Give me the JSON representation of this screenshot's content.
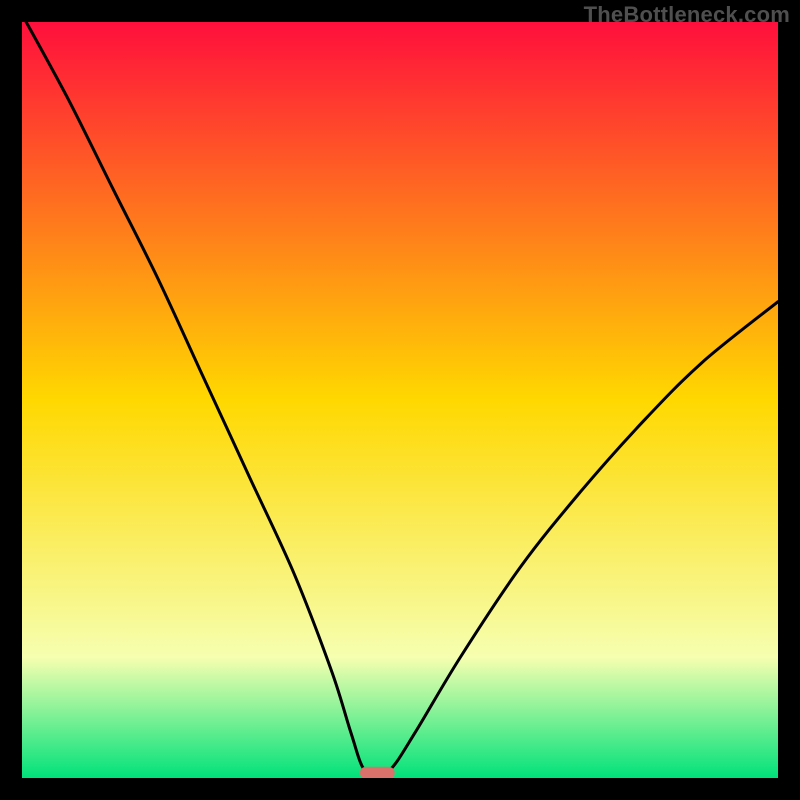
{
  "branding": {
    "watermark": "TheBottleneck.com"
  },
  "colors": {
    "frame_bg": "#000000",
    "grad_top": "#ff0f3c",
    "grad_mid": "#ffd800",
    "grad_low": "#f6ffb0",
    "grad_bottom": "#00e27a",
    "curve": "#000000",
    "marker_fill": "#d9726b",
    "watermark": "#4f4f4f"
  },
  "chart_data": {
    "type": "line",
    "title": "",
    "xlabel": "",
    "ylabel": "",
    "xlim": [
      0,
      100
    ],
    "ylim": [
      0,
      100
    ],
    "x": [
      0,
      6,
      12,
      18,
      24,
      30,
      36,
      41,
      43.5,
      45.2,
      47.0,
      48.8,
      52,
      58,
      66,
      74,
      82,
      90,
      100
    ],
    "values": [
      101,
      90,
      78,
      66,
      53,
      40,
      27,
      14,
      6,
      1.2,
      1.0,
      1.2,
      6,
      16,
      28,
      38,
      47,
      55,
      63
    ],
    "note": "Values are percent bottleneck (y). Curve has a sharp minimum near x≈47 reaching ~1%, left branch runs off the top, right branch rises to ~63% at x=100.",
    "marker": {
      "shape": "rounded-pill",
      "x_center": 47,
      "y_center": 0.7,
      "width_x_units": 4.6,
      "height_y_units": 1.6
    },
    "background_gradient_stops": [
      {
        "offset": 0.0,
        "key": "grad_top"
      },
      {
        "offset": 0.5,
        "key": "grad_mid"
      },
      {
        "offset": 0.84,
        "key": "grad_low"
      },
      {
        "offset": 1.0,
        "key": "grad_bottom"
      }
    ]
  }
}
